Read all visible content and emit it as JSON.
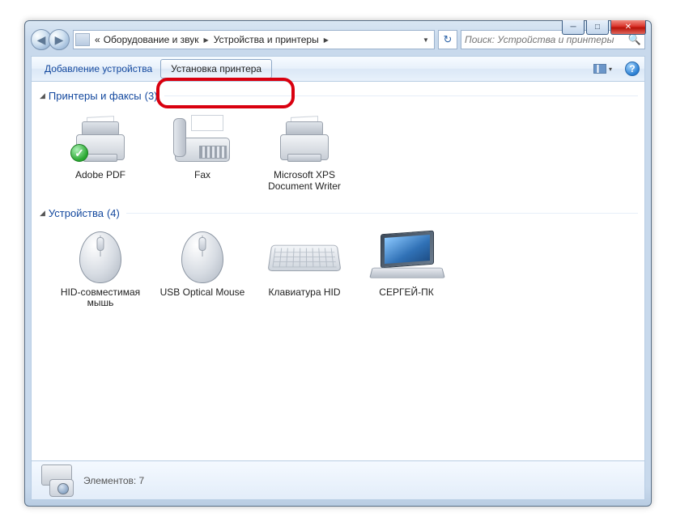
{
  "window_controls": {
    "minimize": "─",
    "maximize": "□",
    "close": "✕"
  },
  "nav": {
    "back_glyph": "◀",
    "forward_glyph": "▶",
    "prefix": "«",
    "segment1": "Оборудование и звук",
    "segment2": "Устройства и принтеры",
    "arrow": "▶",
    "dropdown": "▼",
    "refresh": "↻"
  },
  "search": {
    "placeholder": "Поиск: Устройства и принтеры",
    "icon": "🔍"
  },
  "toolbar": {
    "add_device": "Добавление устройства",
    "add_printer": "Установка принтера",
    "view_dd": "▾",
    "help": "?"
  },
  "groups": [
    {
      "title": "Принтеры и факсы",
      "count": "(3)",
      "items": [
        {
          "label": "Adobe PDF",
          "icon": "printer",
          "default": true
        },
        {
          "label": "Fax",
          "icon": "fax"
        },
        {
          "label": "Microsoft XPS Document Writer",
          "icon": "printer"
        }
      ]
    },
    {
      "title": "Устройства",
      "count": "(4)",
      "items": [
        {
          "label": "HID-совместимая мышь",
          "icon": "mouse"
        },
        {
          "label": "USB Optical Mouse",
          "icon": "mouse"
        },
        {
          "label": "Клавиатура HID",
          "icon": "keyboard"
        },
        {
          "label": "СЕРГЕЙ-ПК",
          "icon": "laptop"
        }
      ]
    }
  ],
  "status": {
    "label": "Элементов: 7"
  }
}
